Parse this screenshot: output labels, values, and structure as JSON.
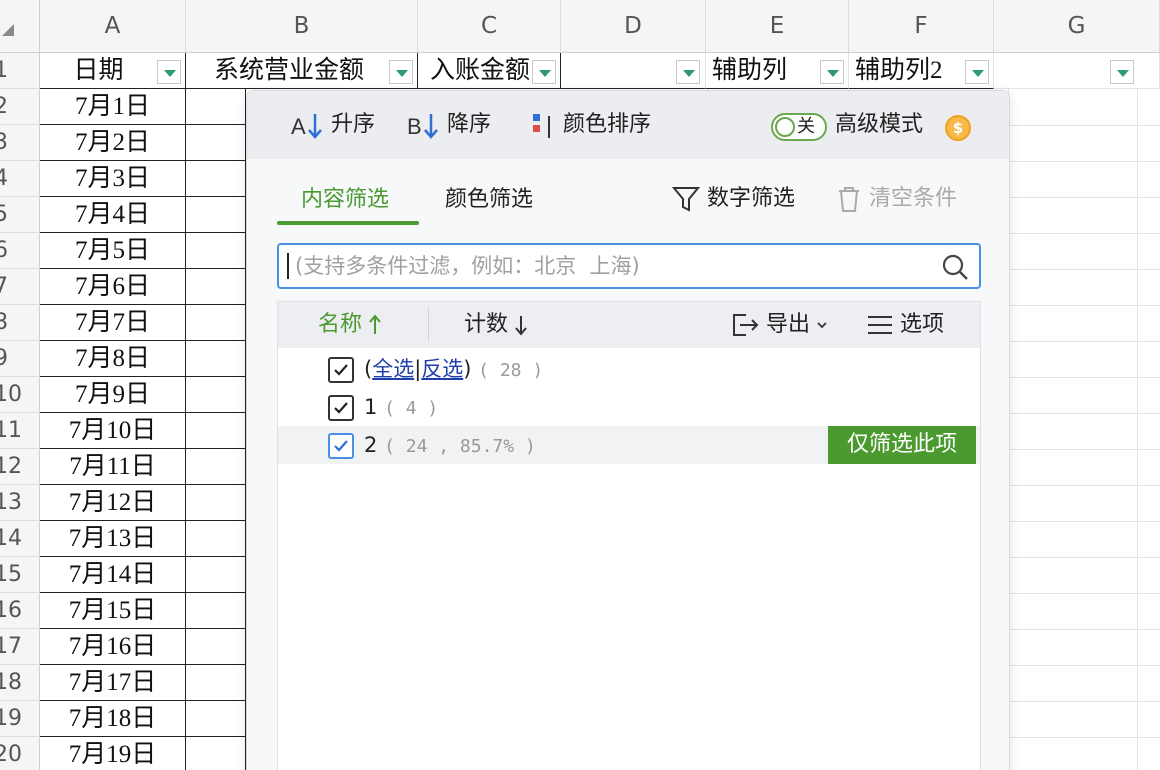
{
  "sheet": {
    "columns": [
      "A",
      "B",
      "C",
      "D",
      "E",
      "F",
      "G"
    ],
    "rows": [
      "1",
      "2",
      "3",
      "4",
      "5",
      "6",
      "7",
      "8",
      "9",
      "10",
      "11",
      "12",
      "13",
      "14",
      "15",
      "16",
      "17",
      "18",
      "19",
      "20"
    ],
    "header_cells": {
      "a": "日期",
      "b": "系统营业金额",
      "c": "入账金额",
      "e": "辅助列",
      "f": "辅助列2"
    },
    "dates": [
      "7月1日",
      "7月2日",
      "7月3日",
      "7月4日",
      "7月5日",
      "7月6日",
      "7月7日",
      "7月8日",
      "7月9日",
      "7月10日",
      "7月11日",
      "7月12日",
      "7月13日",
      "7月14日",
      "7月15日",
      "7月16日",
      "7月17日",
      "7月18日",
      "7月19日"
    ],
    "dropdown_color": "#2e9c6b"
  },
  "filter_panel": {
    "toolbar": {
      "sort_asc": "升序",
      "sort_desc": "降序",
      "color_sort": "颜色排序",
      "toggle_state": "关",
      "advanced_mode": "高级模式"
    },
    "tabs": {
      "content_filter": "内容筛选",
      "color_filter": "颜色筛选",
      "number_filter": "数字筛选",
      "clear_conditions": "清空条件"
    },
    "search": {
      "placeholder": "(支持多条件过滤，例如：北京  上海)"
    },
    "list_header": {
      "name": "名称",
      "count": "计数",
      "export": "导出",
      "options": "选项"
    },
    "items": {
      "select_all": "全选",
      "invert": "反选",
      "all_count": "( 28 )",
      "item1_label": "1",
      "item1_count": "( 4 )",
      "item2_label": "2",
      "item2_count": "( 24 , 85.7% )",
      "only_this": "仅筛选此项"
    },
    "accent_color": "#4a9a2f",
    "link_color": "#1f3fa8"
  }
}
